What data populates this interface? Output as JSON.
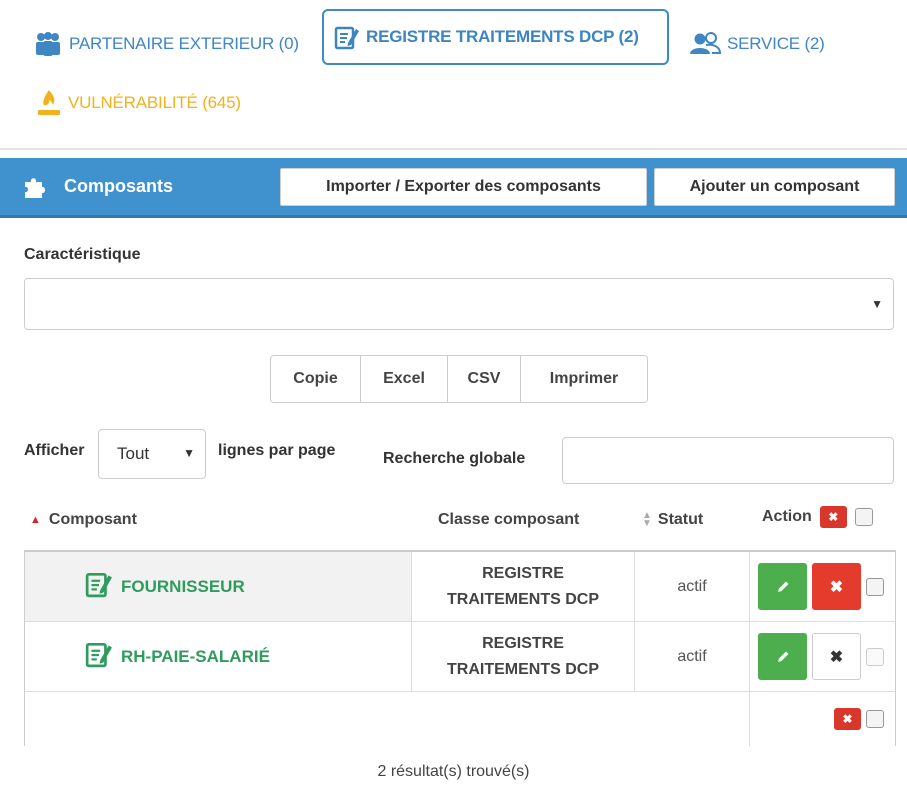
{
  "tabs": [
    {
      "label": "PARTENAIRE EXTERIEUR (0)",
      "icon": "group-icon",
      "color": "#3f86c4"
    },
    {
      "label": "REGISTRE TRAITEMENTS DCP (2)",
      "icon": "edit-document-icon",
      "color": "#3e84c1",
      "active": true
    },
    {
      "label": "SERVICE (2)",
      "icon": "users-icon",
      "color": "#3f86c4"
    },
    {
      "label": "VULNÉRABILITÉ (645)",
      "icon": "fire-icon",
      "color": "#f0b31f"
    }
  ],
  "panel": {
    "title": "Composants",
    "icon": "puzzle-icon",
    "import_label": "Importer / Exporter des composants",
    "add_label": "Ajouter un composant",
    "color": "#3f92cd"
  },
  "filter": {
    "label": "Caractéristique",
    "value": ""
  },
  "export_buttons": [
    "Copie",
    "Excel",
    "CSV",
    "Imprimer"
  ],
  "length": {
    "prefix": "Afficher",
    "value": "Tout",
    "suffix": "lignes par page"
  },
  "search": {
    "label": "Recherche globale",
    "value": ""
  },
  "table": {
    "headers": {
      "composant": "Composant",
      "classe": "Classe composant",
      "statut": "Statut",
      "action": "Action"
    },
    "rows": [
      {
        "composant": "FOURNISSEUR",
        "classe_line1": "REGISTRE",
        "classe_line2": "TRAITEMENTS DCP",
        "statut": "actif"
      },
      {
        "composant": "RH-PAIE-SALARIÉ",
        "classe_line1": "REGISTRE",
        "classe_line2": "TRAITEMENTS DCP",
        "statut": "actif"
      }
    ]
  },
  "footer": "2 résultat(s) trouvé(s)"
}
